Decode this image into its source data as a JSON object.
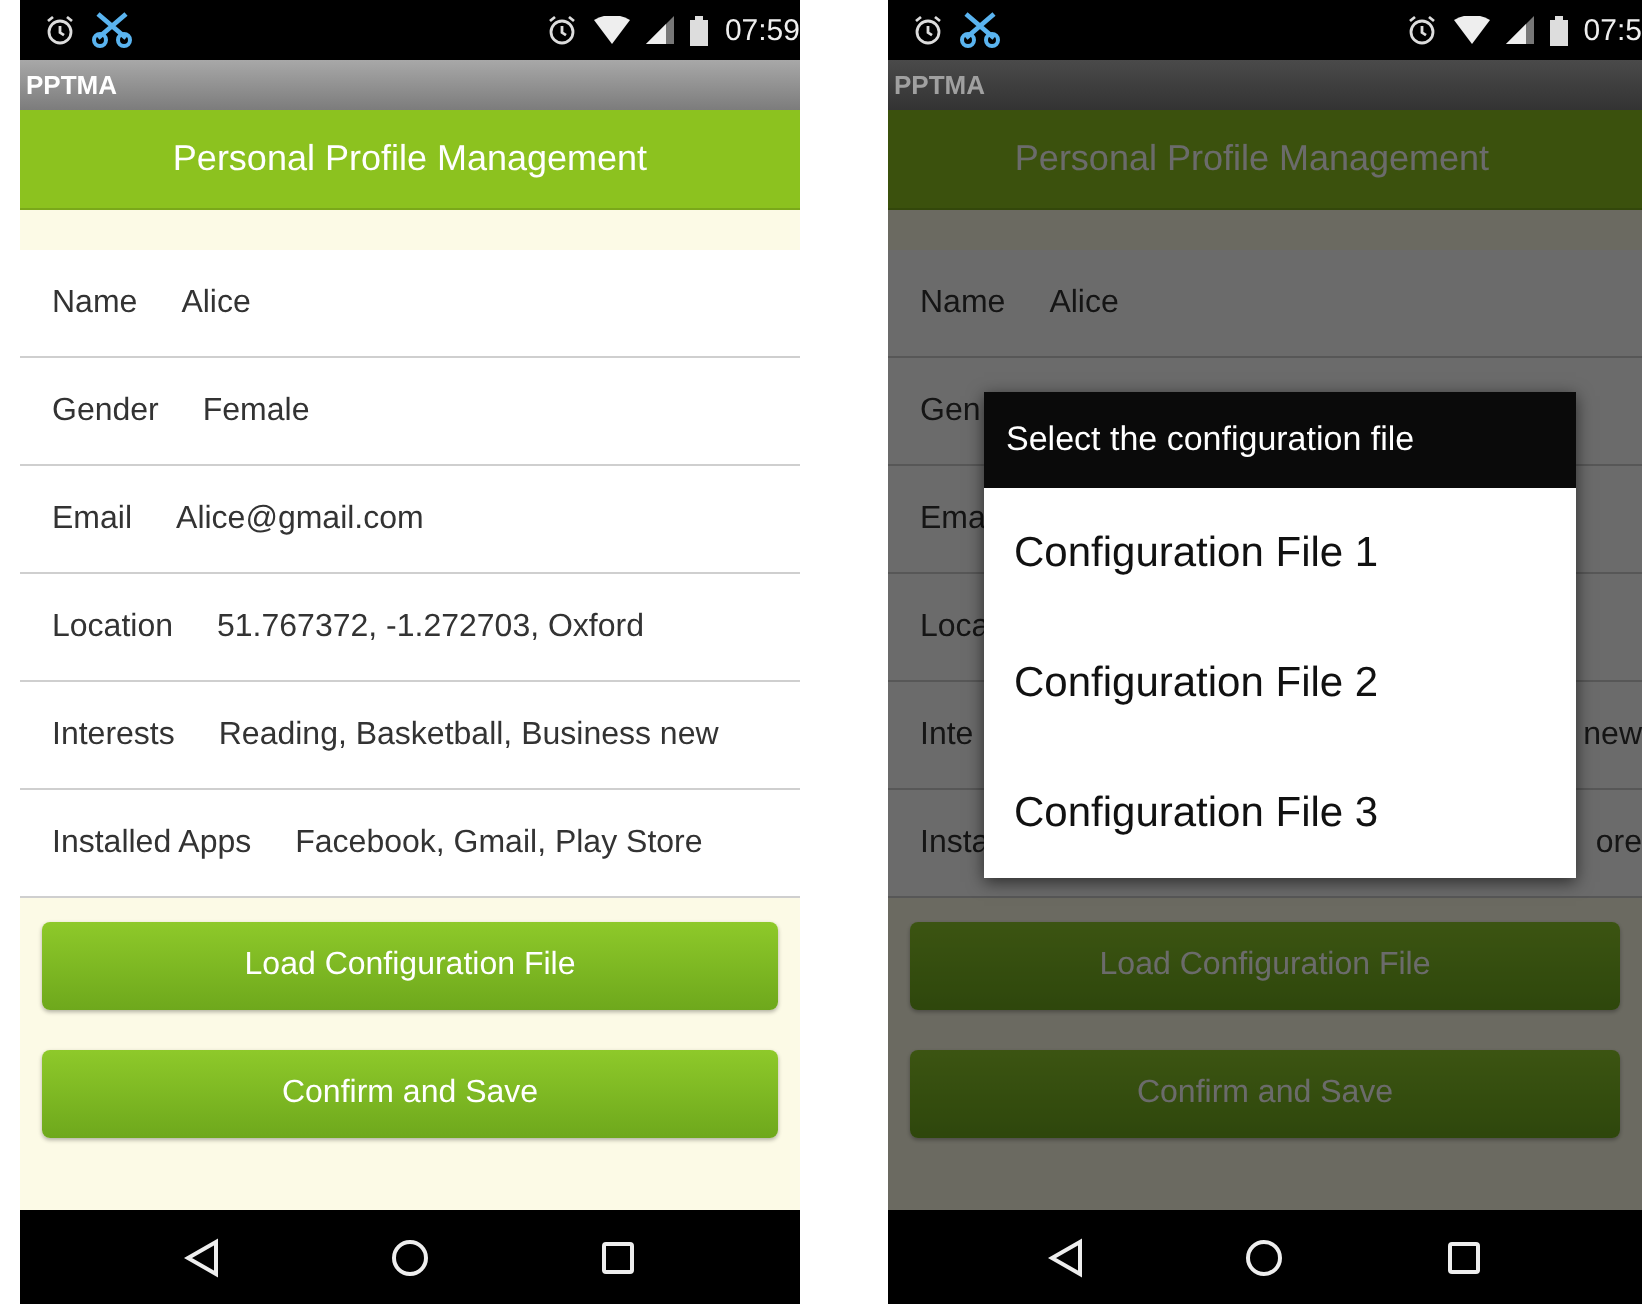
{
  "screens": [
    {
      "dimmed": false,
      "status_bar": {
        "time": "07:59"
      },
      "app_bar": {
        "title": "PPTMA"
      },
      "header": "Personal Profile Management",
      "fields": [
        {
          "label": "Name",
          "value": "Alice"
        },
        {
          "label": "Gender",
          "value": "Female"
        },
        {
          "label": "Email",
          "value": "Alice@gmail.com"
        },
        {
          "label": "Location",
          "value": "51.767372, -1.272703, Oxford"
        },
        {
          "label": "Interests",
          "value": "Reading, Basketball, Business new"
        },
        {
          "label": "Installed Apps",
          "value": "Facebook, Gmail, Play Store"
        }
      ],
      "buttons": [
        "Load Configuration File",
        "Confirm and Save"
      ]
    },
    {
      "dimmed": true,
      "status_bar": {
        "time": "07:5"
      },
      "app_bar": {
        "title": "PPTMA"
      },
      "header": "Personal Profile Management",
      "fields": [
        {
          "label": "Name",
          "value": "Alice"
        },
        {
          "label": "Gen"
        },
        {
          "label": "Ema"
        },
        {
          "label": "Loca"
        },
        {
          "label": "Inte",
          "value_tail": "new"
        },
        {
          "label": "Insta",
          "value_tail": "ore"
        }
      ],
      "buttons": [
        "Load Configuration File",
        "Confirm and Save"
      ],
      "dialog": {
        "title": "Select the configuration file",
        "options": [
          "Configuration File 1",
          "Configuration File 2",
          "Configuration File 3"
        ]
      }
    }
  ]
}
